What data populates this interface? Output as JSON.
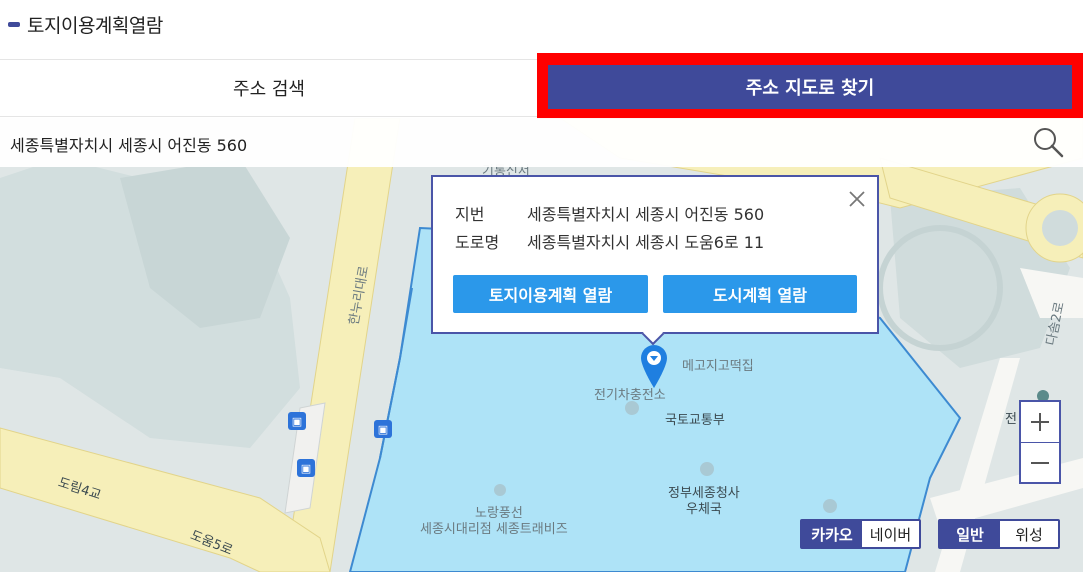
{
  "header": {
    "title": "토지이용계획열람"
  },
  "tabs": {
    "address_search": "주소 검색",
    "find_on_map": "주소 지도로 찾기"
  },
  "address_bar": {
    "value": "세종특별자치시 세종시 어진동 560"
  },
  "popup": {
    "jibun_label": "지번",
    "jibun_value": "세종특별자치시 세종시 어진동 560",
    "road_label": "도로명",
    "road_value": "세종특별자치시 세종시 도움6로 11",
    "btn_land_use": "토지이용계획 열람",
    "btn_city_plan": "도시계획 열람"
  },
  "map_labels": {
    "hannuri": "한누리대로",
    "dasom": "다솜2로",
    "dorim": "도림4교",
    "doum": "도움5로",
    "megoji": "메고지고떡집",
    "charger": "전기차충전소",
    "molit": "국토교통부",
    "gov_complex": "정부세종청사",
    "post_office": "우체국",
    "norang": "노랑풍선",
    "norang_sub": "세종시대리점 세종트래비즈",
    "top_partial": "기통신서",
    "right_partial": "전    선소"
  },
  "map_provider": {
    "kakao": "카카오",
    "naver": "네이버"
  },
  "map_type": {
    "normal": "일반",
    "satellite": "위성"
  },
  "colors": {
    "brand": "#3f4a9a",
    "highlight": "#ff0000",
    "button": "#2b98ea",
    "parcel": "#aee3f7"
  }
}
